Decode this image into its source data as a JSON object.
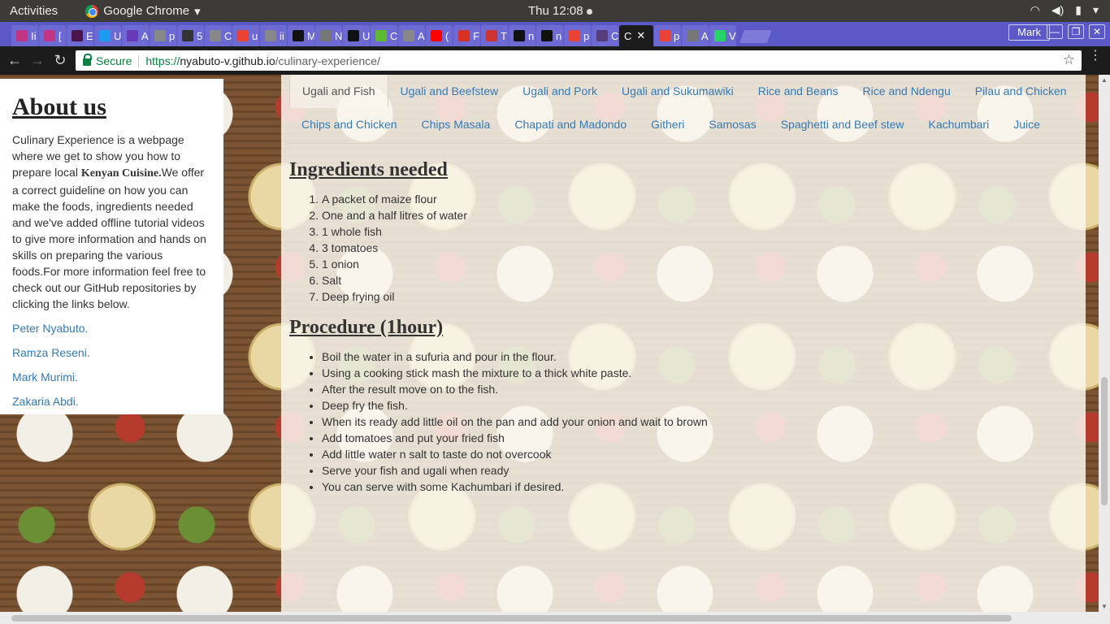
{
  "topbar": {
    "activities": "Activities",
    "app_name": "Google Chrome",
    "app_menu_icon": "chevron-down-icon",
    "clock": "Thu 12:08",
    "tray_icons": [
      "wifi-icon",
      "volume-icon",
      "battery-icon",
      "power-menu-icon"
    ]
  },
  "tabs": [
    {
      "text": "Ii",
      "icon": "instagram-icon",
      "color": "#c13584"
    },
    {
      "text": "[",
      "icon": "instagram-icon",
      "color": "#c13584"
    },
    {
      "text": "E",
      "icon": "slack-icon",
      "color": "#4a154b"
    },
    {
      "text": "U",
      "icon": "x-icon",
      "color": "#1d9bf0"
    },
    {
      "text": "A",
      "icon": "list-icon",
      "color": "#673ab7"
    },
    {
      "text": "p",
      "icon": "document-icon",
      "color": "#888888"
    },
    {
      "text": "5",
      "icon": "camera-icon",
      "color": "#333333"
    },
    {
      "text": "C",
      "icon": "document-icon",
      "color": "#888888"
    },
    {
      "text": "u",
      "icon": "google-icon",
      "color": "#ea4335"
    },
    {
      "text": "ii",
      "icon": "document-icon",
      "color": "#888888"
    },
    {
      "text": "M",
      "icon": "github-icon",
      "color": "#111111"
    },
    {
      "text": "N",
      "icon": "pin-icon",
      "color": "#777777"
    },
    {
      "text": "U",
      "icon": "square-icon",
      "color": "#111111"
    },
    {
      "text": "C",
      "icon": "ad-icon",
      "color": "#5fb832"
    },
    {
      "text": "A",
      "icon": "document-icon",
      "color": "#888888"
    },
    {
      "text": "(",
      "icon": "youtube-icon",
      "color": "#ff0000"
    },
    {
      "text": "F",
      "icon": "gmail-icon",
      "color": "#d93025"
    },
    {
      "text": "T",
      "icon": "app-icon",
      "color": "#cc3333"
    },
    {
      "text": "n",
      "icon": "github-icon",
      "color": "#111111"
    },
    {
      "text": "n",
      "icon": "github-icon",
      "color": "#111111"
    },
    {
      "text": "p",
      "icon": "google-icon",
      "color": "#ea4335"
    },
    {
      "text": "C",
      "icon": "bootstrap-icon",
      "color": "#563d7c"
    },
    {
      "text": "C",
      "icon": "",
      "color": "",
      "active": true
    },
    {
      "text": "p",
      "icon": "google-icon",
      "color": "#ea4335"
    },
    {
      "text": "A",
      "icon": "bulb-icon",
      "color": "#777777"
    },
    {
      "text": "V",
      "icon": "whatsapp-icon",
      "color": "#25d366"
    }
  ],
  "window": {
    "profile": "Mark",
    "minimize": "—",
    "maximize": "❐",
    "close": "✕"
  },
  "address_bar": {
    "secure_label": "Secure",
    "url_scheme": "https://",
    "url_host": "nyabuto-v.github.io",
    "url_path": "/culinary-experience/"
  },
  "sidebar": {
    "title": "About us",
    "intro_1": "Culinary Experience is a webpage where we get to show you how to prepare local ",
    "intro_bold": "Kenyan Cuisine.",
    "intro_2": "We offer a correct guideline on how you can make the foods, ingredients needed and we've added offline tutorial videos to give more information and hands on skills on preparing the various foods.For more information feel free to check out our GitHub repositories by clicking the links below.",
    "links": [
      "Peter Nyabuto.",
      "Ramza Reseni.",
      "Mark Murimi.",
      "Zakaria Abdi."
    ]
  },
  "dish_tabs": [
    "Ugali and Fish",
    "Ugali and Beefstew",
    "Ugali and Pork",
    "Ugali and Sukumawiki",
    "Rice and Beans",
    "Rice and Ndengu",
    "Pilau and Chicken",
    "Chips and Chicken",
    "Chips Masala",
    "Chapati and Madondo",
    "Githeri",
    "Samosas",
    "Spaghetti and Beef stew",
    "Kachumbari",
    "Juice"
  ],
  "active_dish": "Ugali and Fish",
  "ingredients": {
    "heading": "Ingredients needed",
    "items": [
      "A packet of maize flour",
      "One and a half litres of water",
      "1 whole fish",
      "3 tomatoes",
      "1 onion",
      "Salt",
      "Deep frying oil"
    ]
  },
  "procedure": {
    "heading": "Procedure (1hour)",
    "steps": [
      "Boil the water in a sufuria and pour in the flour.",
      "Using a cooking stick mash the mixture to a thick white paste.",
      "After the result move on to the fish.",
      "Deep fry the fish.",
      "When its ready add little oil on the pan and add your onion and wait to brown",
      "Add tomatoes and put your fried fish",
      "Add little water n salt to taste do not overcook",
      "Serve your fish and ugali when ready",
      "You can serve with some Kachumbari if desired."
    ]
  }
}
